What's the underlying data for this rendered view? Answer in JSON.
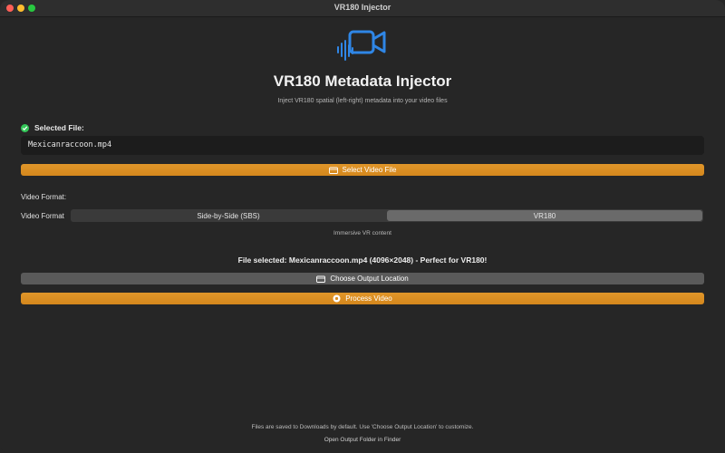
{
  "window": {
    "title": "VR180 Injector"
  },
  "header": {
    "icon": "video-camera-waveform-icon",
    "title": "VR180 Metadata Injector",
    "subtitle": "Inject VR180 spatial (left-right) metadata into your video files"
  },
  "file": {
    "label": "Selected File:",
    "status_icon": "checkmark-circle-icon",
    "value": "Mexicanraccoon.mp4",
    "select_button": "Select Video File"
  },
  "format": {
    "heading": "Video Format:",
    "row_label": "Video Format",
    "options": [
      "Side-by-Side (SBS)",
      "VR180"
    ],
    "selected": "VR180",
    "description": "Immersive VR content"
  },
  "status": {
    "message": "File selected: Mexicanraccoon.mp4 (4096×2048) - Perfect for VR180!"
  },
  "actions": {
    "output_button": "Choose Output Location",
    "process_button": "Process Video"
  },
  "footer": {
    "note": "Files are saved to Downloads by default. Use 'Choose Output Location' to customize.",
    "link": "Open Output Folder in Finder"
  },
  "colors": {
    "accent_orange": "#d98d22",
    "icon_blue": "#2f86e6",
    "success_green": "#34c759",
    "background": "#262626"
  }
}
